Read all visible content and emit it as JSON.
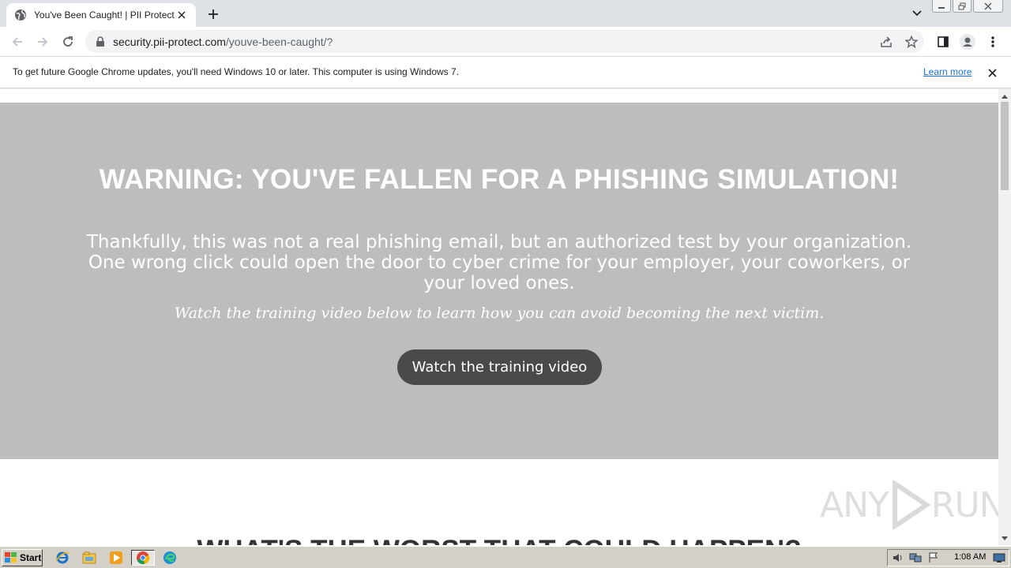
{
  "browser": {
    "tab_title": "You've Been Caught! | PII Protect",
    "url_host": "security.pii-protect.com",
    "url_path": "/youve-been-caught/?"
  },
  "infobar": {
    "message": "To get future Google Chrome updates, you'll need Windows 10 or later. This computer is using Windows 7.",
    "learn_more": "Learn more"
  },
  "page": {
    "warning_heading": "WARNING: YOU'VE FALLEN FOR A PHISHING SIMULATION!",
    "lead_text": "Thankfully, this was not a real phishing email, but an authorized test by your organization. One wrong click could open the door to cyber crime for your employer, your coworkers, or your loved ones.",
    "sub_text": "Watch the training video below to learn how you can avoid becoming the next victim.",
    "cta_label": "Watch the training video",
    "next_heading": "WHAT'S THE WORST THAT COULD HAPPEN?",
    "hero_color": "#bdbdbd",
    "button_color": "#4a4a4a"
  },
  "watermark": {
    "text_left": "ANY",
    "text_right": "RUN"
  },
  "taskbar": {
    "start_label": "Start",
    "clock": "1:08 AM",
    "pinned_icons": [
      "ie-icon",
      "explorer-icon",
      "media-player-icon",
      "chrome-icon",
      "edge-icon"
    ]
  }
}
